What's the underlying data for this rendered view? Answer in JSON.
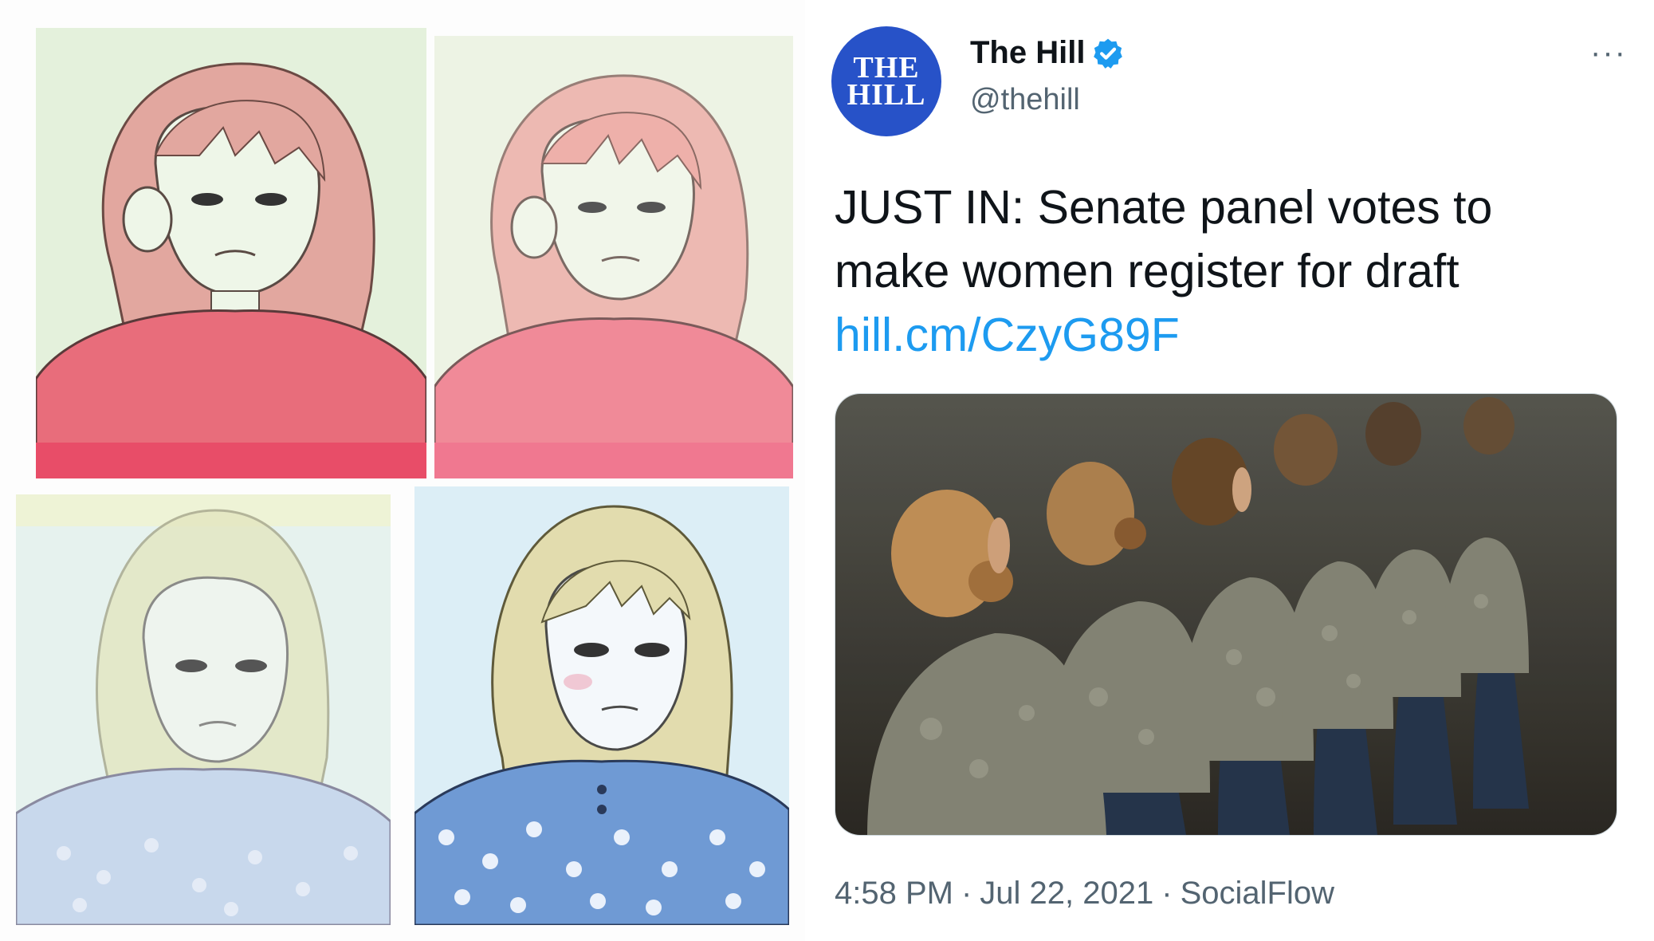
{
  "meme": {
    "panels": [
      "girl-red-shirt",
      "girl-red-shirt-faded",
      "blonde-overlay-faded",
      "blonde-floral-dress"
    ]
  },
  "tweet": {
    "avatar_line1": "THE",
    "avatar_line2": "HILL",
    "display_name": "The Hill",
    "verified_icon": "verified-badge-icon",
    "handle": "@thehill",
    "more_label": "···",
    "text_line1": "JUST IN: Senate panel votes to",
    "text_line2": "make women register for draft",
    "link": "hill.cm/CzyG89F",
    "time": "4:58 PM",
    "date": "Jul 22, 2021",
    "source": "SocialFlow",
    "separator": "·"
  },
  "colors": {
    "accent": "#1d9bf0",
    "brand": "#2752c8",
    "text": "#0f1419",
    "muted": "#536471"
  }
}
